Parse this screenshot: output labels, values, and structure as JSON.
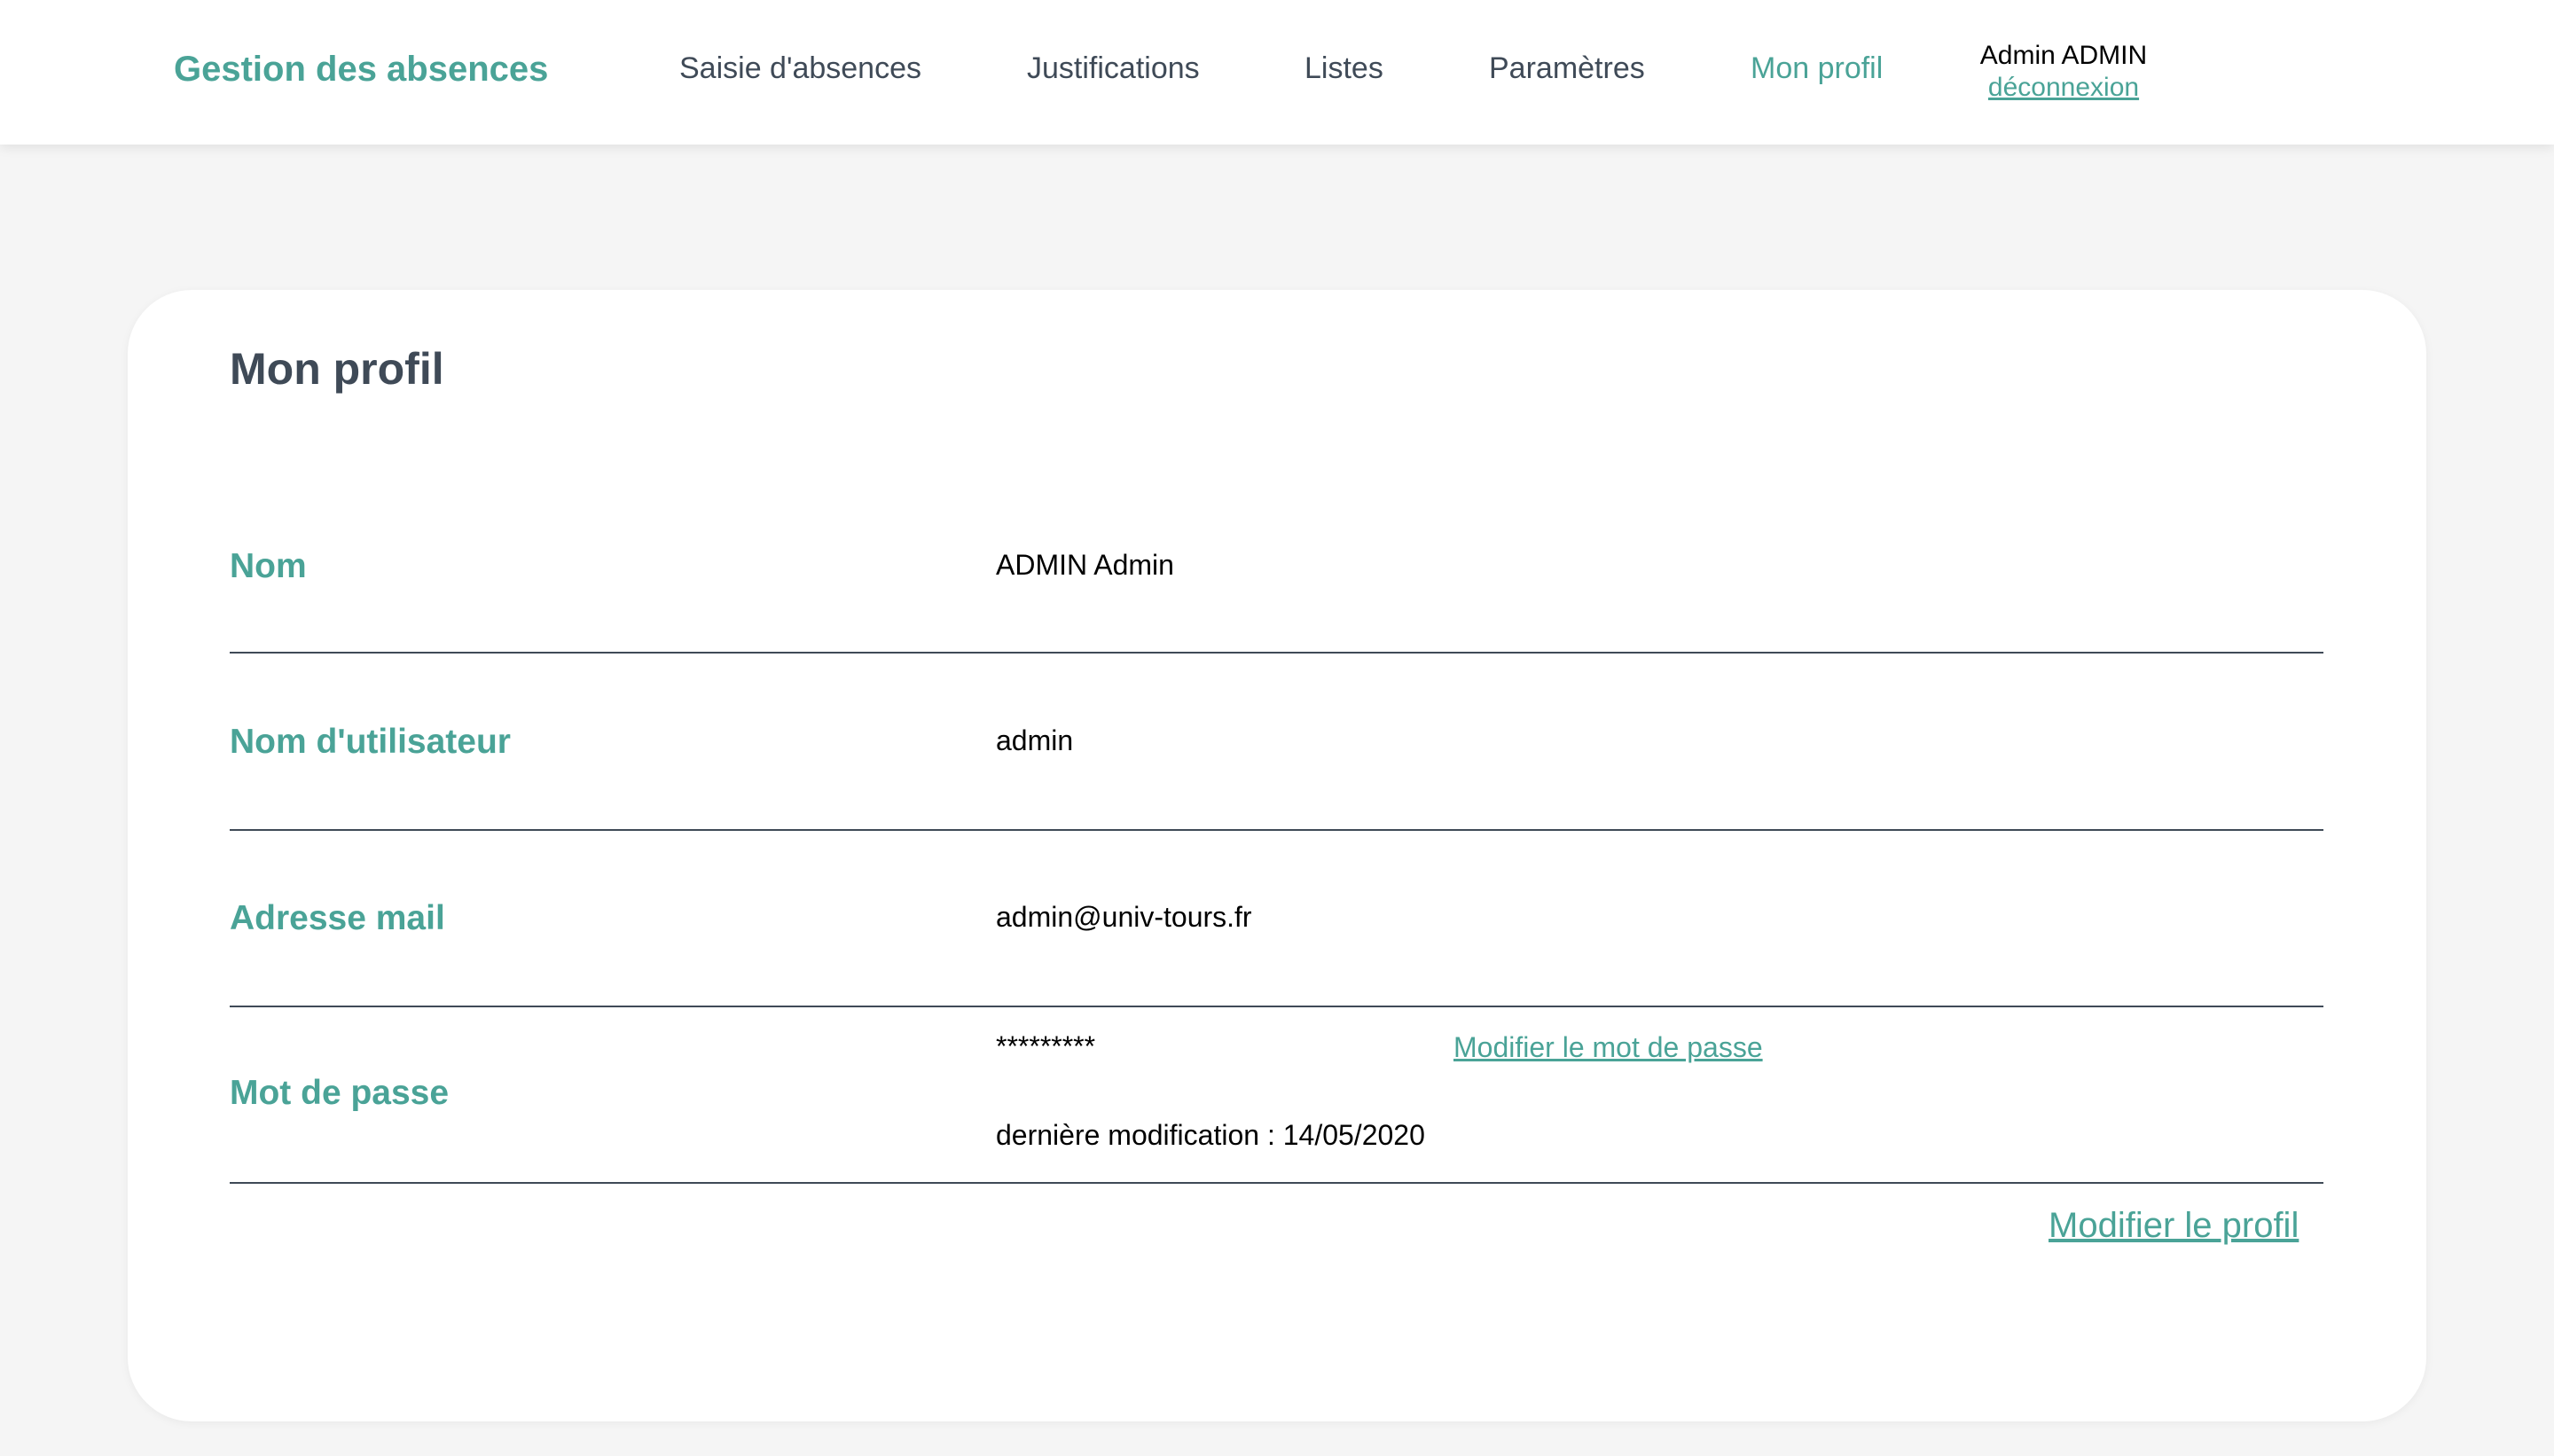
{
  "header": {
    "brand": "Gestion des absences",
    "nav": {
      "saisie": "Saisie d'absences",
      "justifications": "Justifications",
      "listes": "Listes",
      "parametres": "Paramètres",
      "profil": "Mon profil"
    },
    "active_nav": "profil",
    "user": {
      "name": "Admin ADMIN",
      "logout": "déconnexion"
    }
  },
  "profile": {
    "title": "Mon profil",
    "fields": {
      "nom": {
        "label": "Nom",
        "value": "ADMIN Admin"
      },
      "username": {
        "label": "Nom d'utilisateur",
        "value": "admin"
      },
      "email": {
        "label": "Adresse mail",
        "value": "admin@univ-tours.fr"
      },
      "password": {
        "label": "Mot de passe",
        "value": "*********",
        "change_link": "Modifier le mot de passe",
        "last_modified": "dernière modification : 14/05/2020"
      }
    },
    "edit_link": "Modifier le profil"
  },
  "colors": {
    "accent": "#4aa397",
    "text_dark": "#3f4a57",
    "background": "#f5f5f5",
    "card": "#ffffff"
  }
}
